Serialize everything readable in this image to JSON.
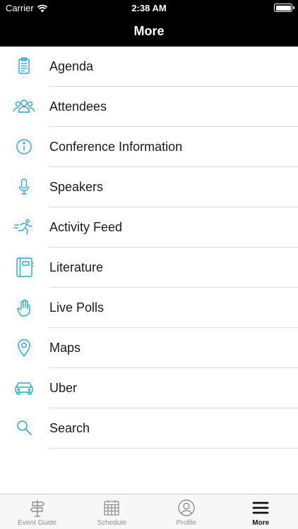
{
  "status_bar": {
    "carrier": "Carrier",
    "time": "2:38 AM"
  },
  "nav": {
    "title": "More"
  },
  "accent_color": "#2aa8c8",
  "menu": [
    {
      "label": "Agenda",
      "icon": "clipboard-icon"
    },
    {
      "label": "Attendees",
      "icon": "people-icon"
    },
    {
      "label": "Conference Information",
      "icon": "info-icon"
    },
    {
      "label": "Speakers",
      "icon": "microphone-icon"
    },
    {
      "label": "Activity Feed",
      "icon": "runner-icon"
    },
    {
      "label": "Literature",
      "icon": "notebook-icon"
    },
    {
      "label": "Live Polls",
      "icon": "hand-icon"
    },
    {
      "label": "Maps",
      "icon": "map-pin-icon"
    },
    {
      "label": "Uber",
      "icon": "car-icon"
    },
    {
      "label": "Search",
      "icon": "search-icon"
    }
  ],
  "tabs": [
    {
      "label": "Event Guide",
      "icon": "signpost-icon",
      "active": false
    },
    {
      "label": "Schedule",
      "icon": "calendar-icon",
      "active": false
    },
    {
      "label": "Profile",
      "icon": "profile-icon",
      "active": false
    },
    {
      "label": "More",
      "icon": "hamburger-icon",
      "active": true
    }
  ]
}
